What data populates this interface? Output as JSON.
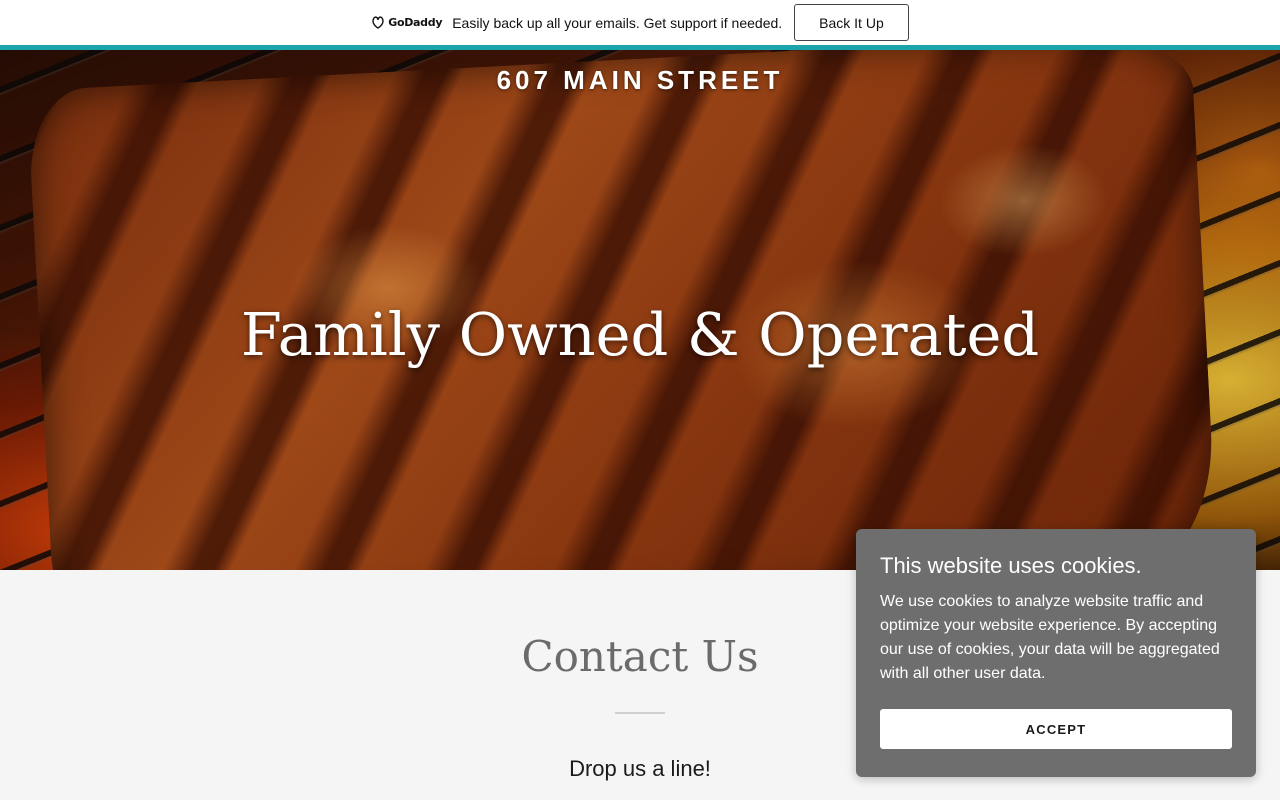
{
  "promo": {
    "logo_text": "GoDaddy",
    "message": "Easily back up all your emails. Get support if needed.",
    "button_label": "Back It Up"
  },
  "hero": {
    "site_title": "607 MAIN STREET",
    "tagline": "Family Owned & Operated"
  },
  "contact": {
    "heading": "Contact Us",
    "subheading": "Drop us a line!"
  },
  "cookie_banner": {
    "title": "This website uses cookies.",
    "body": "We use cookies to analyze website traffic and optimize your website experience. By accepting our use of cookies, your data will be aggregated with all other user data.",
    "accept_label": "ACCEPT"
  },
  "colors": {
    "accent_teal": "#1ba4aa",
    "cookie_bg": "#6e6e6e",
    "heading_gray": "#6b6b6b"
  }
}
